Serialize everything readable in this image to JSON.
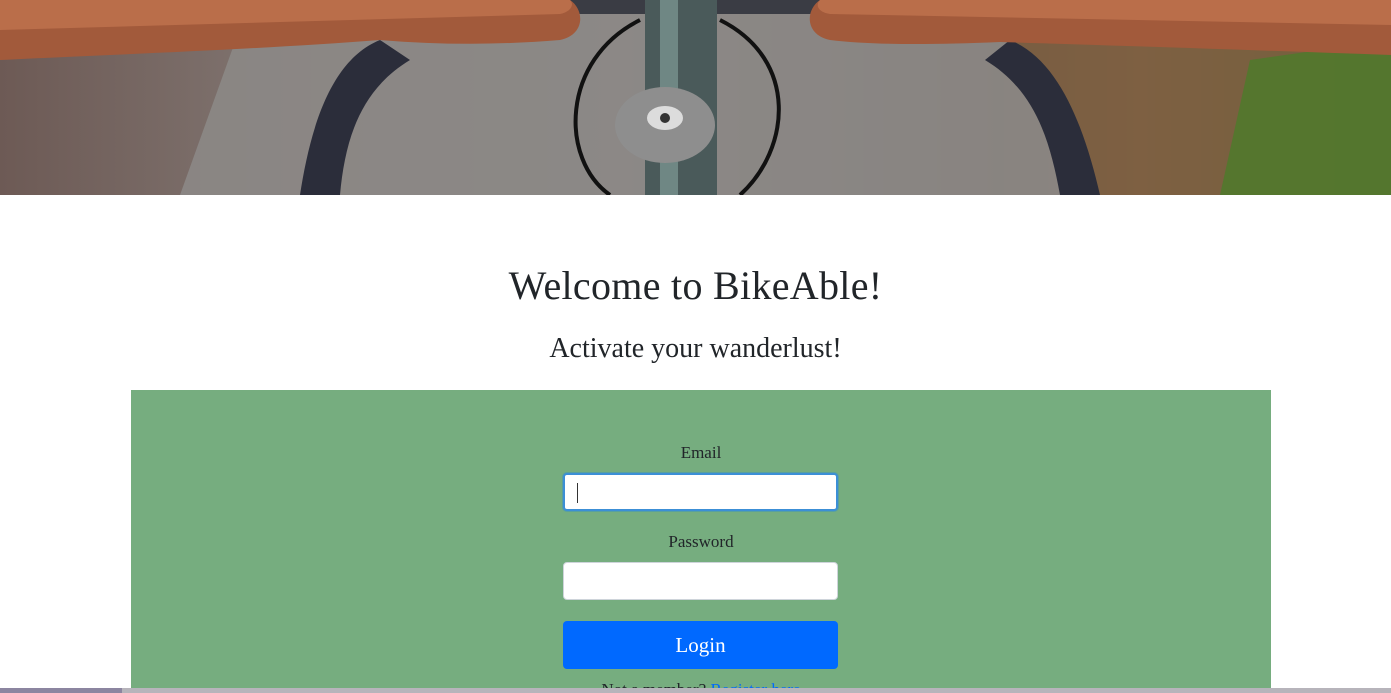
{
  "hero": {
    "image_alt": "Bike handlebars on a road"
  },
  "welcome": {
    "title": "Welcome to BikeAble!",
    "subtitle": "Activate your wanderlust!"
  },
  "login_form": {
    "email_label": "Email",
    "email_value": "",
    "password_label": "Password",
    "password_value": "",
    "login_button": "Login",
    "register_prompt": "Not a member?",
    "register_link": "Register here"
  },
  "colors": {
    "panel_background": "#76ad7f",
    "button_background": "#0069ff",
    "link_color": "#0069ff",
    "focus_border": "#3c8fd6"
  }
}
